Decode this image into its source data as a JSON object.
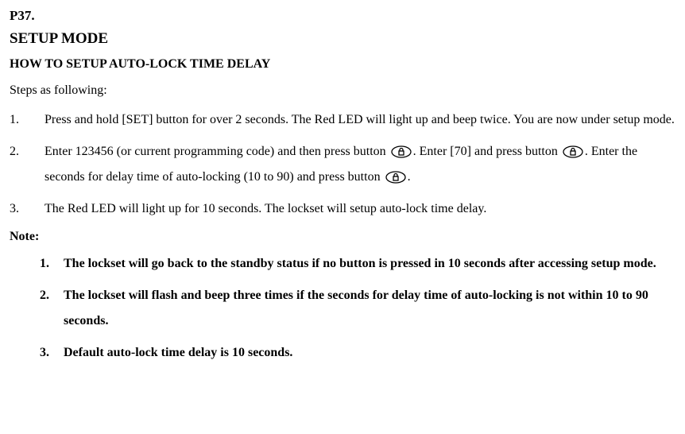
{
  "page_label": "P37.",
  "section_title": "SETUP MODE",
  "subsection_title": "HOW TO SETUP AUTO-LOCK TIME DELAY",
  "steps_intro": "Steps as following:",
  "steps": [
    {
      "num": "1.",
      "text": "Press and hold [SET] button for over 2 seconds. The Red LED will light up and beep twice. You are now under setup mode."
    },
    {
      "num": "2.",
      "part1": "Enter 123456 (or current programming code) and then press button ",
      "part2": ". Enter [70] and press button ",
      "part3": ". Enter the seconds for delay time of auto-locking (10 to 90) and press button ",
      "part4": "."
    },
    {
      "num": "3.",
      "text": "The Red LED will light up for 10 seconds. The lockset will setup auto-lock time delay."
    }
  ],
  "note_label": "Note:",
  "notes": [
    {
      "num": "1.",
      "text": "The lockset will go back to the standby status if no button is pressed in 10 seconds after accessing setup mode."
    },
    {
      "num": "2.",
      "text": "The lockset will flash and beep three times if the seconds for delay time of auto-locking is not within 10 to 90 seconds."
    },
    {
      "num": "3.",
      "text": "Default auto-lock time delay is 10 seconds."
    }
  ],
  "icons": {
    "lock_button": "lock-button-icon"
  }
}
